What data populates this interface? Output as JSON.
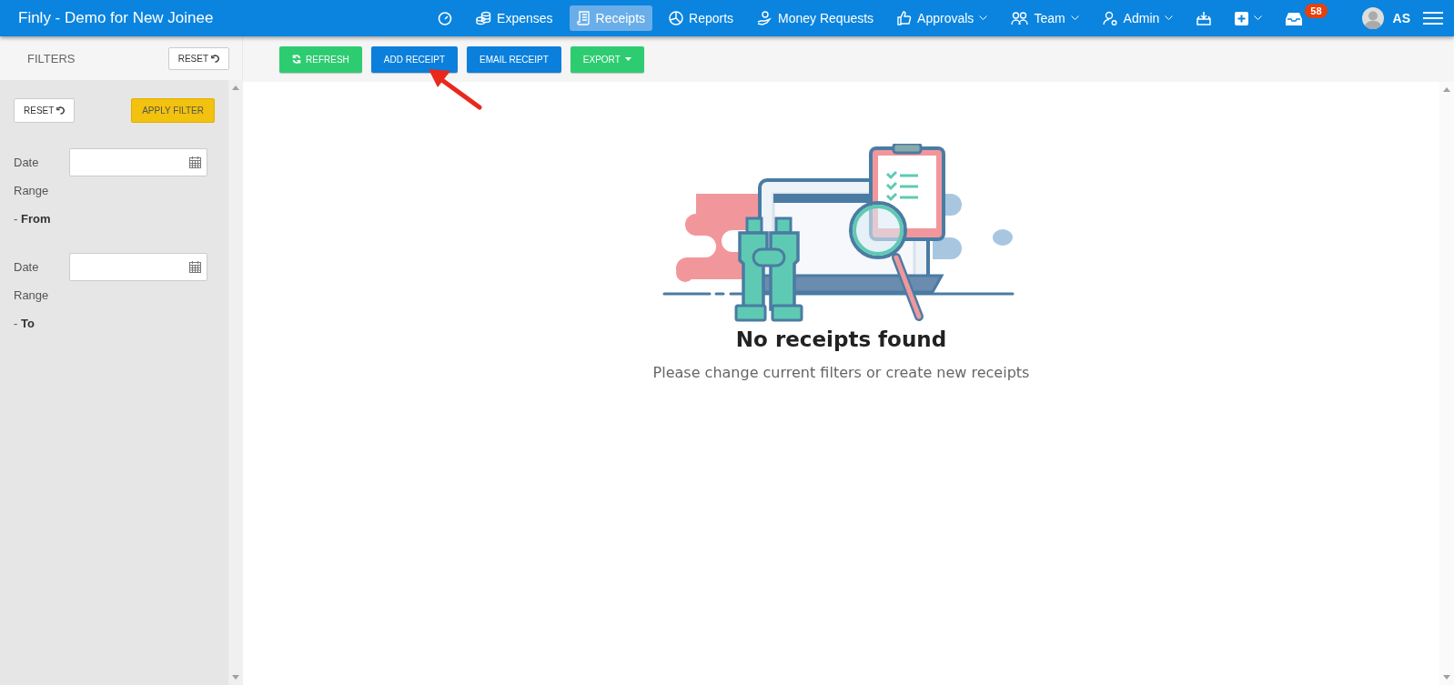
{
  "app_title": "Finly - Demo for New Joinee",
  "nav": [
    {
      "selected": false,
      "dropdown": false
    },
    {
      "label": "Expenses",
      "selected": false,
      "dropdown": false
    },
    {
      "label": "Receipts",
      "selected": true,
      "dropdown": false
    },
    {
      "label": "Reports",
      "selected": false,
      "dropdown": false
    },
    {
      "label": "Money Requests",
      "selected": false,
      "dropdown": false
    },
    {
      "label": "Approvals",
      "selected": false,
      "dropdown": true
    },
    {
      "label": "Team",
      "selected": false,
      "dropdown": true
    },
    {
      "label": "Admin",
      "selected": false,
      "dropdown": true
    },
    {
      "selected": false,
      "dropdown": false
    },
    {
      "selected": false,
      "dropdown": true
    },
    {
      "selected": false,
      "dropdown": false,
      "badge": "58"
    }
  ],
  "user": {
    "initials": "AS"
  },
  "filters": {
    "title": "FILTERS",
    "reset_top": "RESET",
    "reset": "RESET",
    "apply": "APPLY FILTER",
    "fields": [
      {
        "label": "Date Range - **From**"
      },
      {
        "label": "Date Range - **To**"
      }
    ]
  },
  "toolbar": [
    {
      "label": "REFRESH",
      "kind": "success",
      "dropdown": false
    },
    {
      "label": "ADD RECEIPT",
      "kind": "primary",
      "dropdown": false
    },
    {
      "label": "EMAIL RECEIPT",
      "kind": "primary",
      "dropdown": false
    },
    {
      "label": "EXPORT",
      "kind": "success",
      "dropdown": true
    }
  ],
  "empty": {
    "title": "No receipts found",
    "message": "Please change current filters or create new receipts"
  }
}
